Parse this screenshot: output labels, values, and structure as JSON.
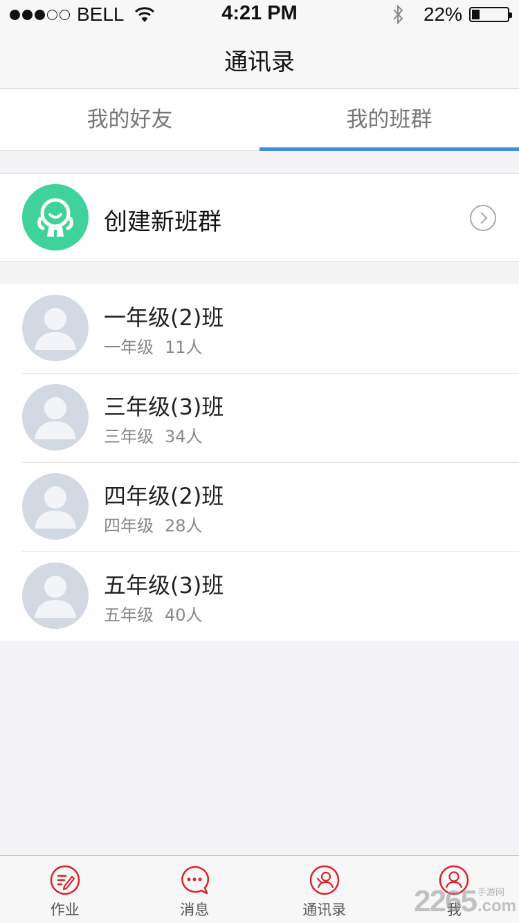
{
  "status_bar": {
    "carrier": "BELL",
    "time": "4:21 PM",
    "battery": "22%",
    "battery_level": 0.22,
    "signal_bars": 3
  },
  "nav": {
    "title": "通讯录"
  },
  "tabs": [
    {
      "label": "我的好友",
      "active": false
    },
    {
      "label": "我的班群",
      "active": true
    }
  ],
  "create_group": {
    "label": "创建新班群",
    "icon": "group-mascot-icon",
    "accent": "#3fd39b"
  },
  "classes": [
    {
      "name": "一年级(2)班",
      "grade": "一年级",
      "count": "11人"
    },
    {
      "name": "三年级(3)班",
      "grade": "三年级",
      "count": "34人"
    },
    {
      "name": "四年级(2)班",
      "grade": "四年级",
      "count": "28人"
    },
    {
      "name": "五年级(3)班",
      "grade": "五年级",
      "count": "40人"
    }
  ],
  "tab_bar": [
    {
      "label": "作业",
      "icon": "homework-icon"
    },
    {
      "label": "消息",
      "icon": "message-icon"
    },
    {
      "label": "通讯录",
      "icon": "contacts-icon"
    },
    {
      "label": "我",
      "icon": "profile-icon"
    }
  ],
  "colors": {
    "accent_blue": "#3c8ee0",
    "tab_red": "#d9232d"
  },
  "watermark": {
    "number": "2265",
    "text": "手游网",
    "suffix": ".com"
  }
}
